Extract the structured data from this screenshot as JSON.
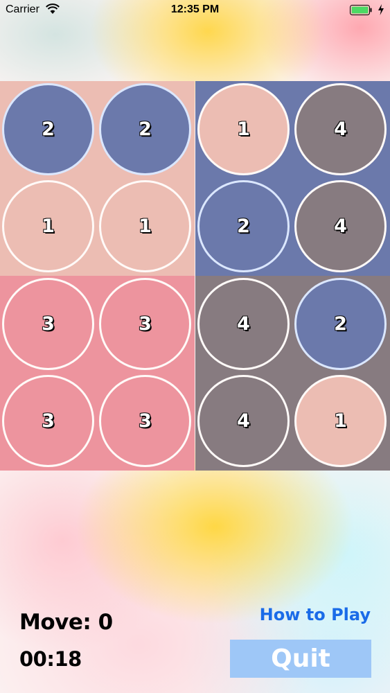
{
  "status_bar": {
    "carrier": "Carrier",
    "time": "12:35 PM",
    "icons": [
      "wifi-icon",
      "battery-icon",
      "charge-icon"
    ],
    "battery_color": "#4cd964"
  },
  "colors": {
    "pink": "#ecbdb3",
    "blue": "#6b79ab",
    "gray": "#877b80",
    "rose": "#ed949e"
  },
  "board": {
    "quadrants": [
      {
        "name": "top-left",
        "background": "#ecbdb3",
        "cells": [
          {
            "value": "2",
            "color": "#6b79ab"
          },
          {
            "value": "2",
            "color": "#6b79ab"
          },
          {
            "value": "1",
            "color": "#ecbdb3"
          },
          {
            "value": "1",
            "color": "#ecbdb3"
          }
        ]
      },
      {
        "name": "top-right",
        "background": "#6b79ab",
        "cells": [
          {
            "value": "1",
            "color": "#ecbdb3"
          },
          {
            "value": "4",
            "color": "#877b80"
          },
          {
            "value": "2",
            "color": "#6b79ab"
          },
          {
            "value": "4",
            "color": "#877b80"
          }
        ]
      },
      {
        "name": "bottom-left",
        "background": "#ed949e",
        "cells": [
          {
            "value": "3",
            "color": "#ed949e"
          },
          {
            "value": "3",
            "color": "#ed949e"
          },
          {
            "value": "3",
            "color": "#ed949e"
          },
          {
            "value": "3",
            "color": "#ed949e"
          }
        ]
      },
      {
        "name": "bottom-right",
        "background": "#877b80",
        "cells": [
          {
            "value": "4",
            "color": "#877b80"
          },
          {
            "value": "2",
            "color": "#6b79ab"
          },
          {
            "value": "4",
            "color": "#877b80"
          },
          {
            "value": "1",
            "color": "#ecbdb3"
          }
        ]
      }
    ]
  },
  "footer": {
    "move_text": "Move: 0",
    "timer": "00:18",
    "how_to_play_label": "How to Play",
    "quit_label": "Quit",
    "quit_color": "#9ec7f7",
    "how_to_play_color": "#1a6be8"
  }
}
